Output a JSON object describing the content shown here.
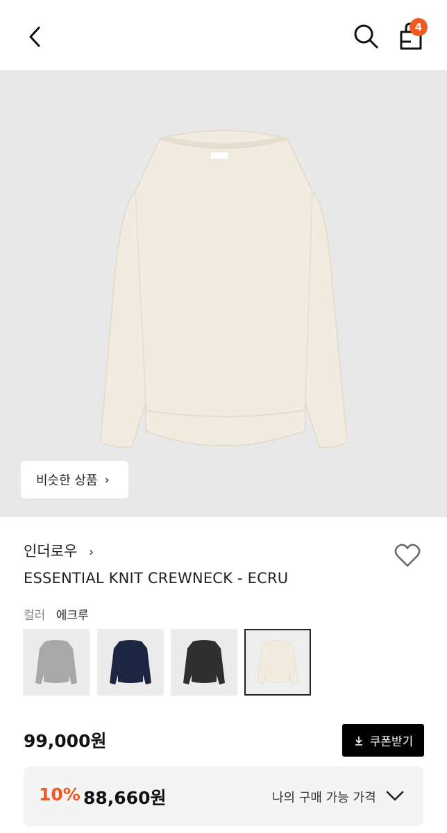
{
  "header": {
    "back_icon": "chevron-left-icon",
    "search_icon": "search-icon",
    "bag_icon": "shopping-bag-icon",
    "bag_count": "4",
    "badge_color": "#f05a22"
  },
  "product": {
    "image_alt": "ESSENTIAL KNIT CREWNECK - ECRU",
    "similar_label": "비슷한 상품",
    "brand": "인더로우",
    "title": "ESSENTIAL KNIT CREWNECK - ECRU",
    "wishlist_icon": "heart-icon",
    "color_label": "컬러",
    "color_value": "에크루",
    "swatches": [
      {
        "name": "gray",
        "color": "#a8a8a8"
      },
      {
        "name": "navy",
        "color": "#1c2542"
      },
      {
        "name": "charcoal",
        "color": "#2f2f2f"
      },
      {
        "name": "ecru",
        "color": "#f1ebe0",
        "selected": true
      }
    ]
  },
  "pricing": {
    "price": "99,000원",
    "coupon_label": "쿠폰받기",
    "discount": "10%",
    "final_price": "88,660원",
    "my_price_label": "나의 구매 가능 가격",
    "accent_color": "#f05a22"
  }
}
